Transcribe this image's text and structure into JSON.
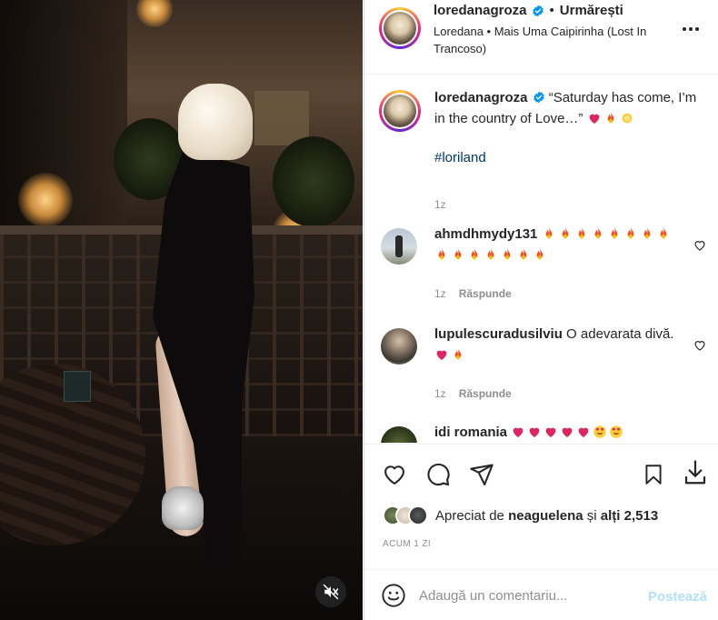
{
  "post": {
    "media": {
      "mute_icon": "speaker-muted-icon"
    },
    "header": {
      "username": "loredanagroza",
      "separator": "•",
      "follow_label": "Urmărești",
      "audio": "Loredana • Mais Uma Caipirinha (Lost In Trancoso)"
    },
    "caption": {
      "username": "loredanagroza",
      "text": "“Saturday has come, I’m in the country of Love…”",
      "hashtag": "#loriland",
      "time": "1z"
    },
    "comments": [
      {
        "username": "ahmdhmydy131",
        "emoji": [
          "fire",
          "fire",
          "fire",
          "fire",
          "fire",
          "fire",
          "fire",
          "fire",
          "fire",
          "fire",
          "fire",
          "fire",
          "fire",
          "fire",
          "fire"
        ],
        "time": "1z",
        "reply": "Răspunde"
      },
      {
        "username": "lupulescuradusilviu",
        "text": "O adevarata divă.",
        "emoji": [
          "heart",
          "fire"
        ],
        "time": "1z",
        "reply": "Răspunde"
      },
      {
        "username": "idi romania",
        "emoji": [
          "heart",
          "heart",
          "heart",
          "heart",
          "heart",
          "heart-eyes",
          "heart-eyes"
        ]
      }
    ],
    "likes": {
      "prefix": "Apreciat de",
      "user": "neaguelena",
      "middle": "și",
      "others": "alți 2,513"
    },
    "timestamp": "ACUM 1 ZI",
    "add_comment": {
      "placeholder": "Adaugă un comentariu...",
      "post_label": "Postează"
    }
  },
  "colors": {
    "link": "#00376b",
    "secondary_text": "#8e8e8e",
    "post_button_disabled": "#b2dffc",
    "verified": "#0095f6"
  }
}
